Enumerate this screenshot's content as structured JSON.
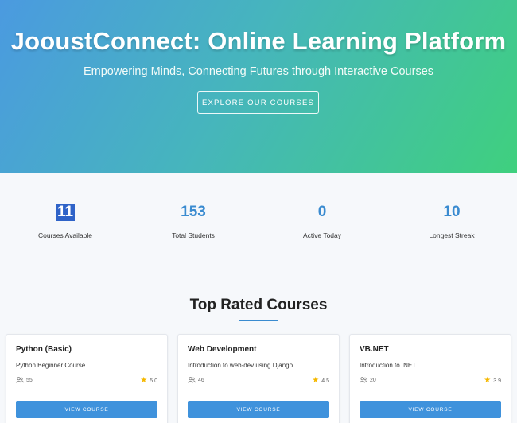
{
  "hero": {
    "title": "JooustConnect: Online Learning Platform",
    "subtitle": "Empowering Minds, Connecting Futures through Interactive Courses",
    "cta_label": "EXPLORE OUR COURSES"
  },
  "stats": [
    {
      "value": "11",
      "label": "Courses Available"
    },
    {
      "value": "153",
      "label": "Total Students"
    },
    {
      "value": "0",
      "label": "Active Today"
    },
    {
      "value": "10",
      "label": "Longest Streak"
    }
  ],
  "top_rated": {
    "title": "Top Rated Courses",
    "courses": [
      {
        "title": "Python (Basic)",
        "description": "Python Beginner Course",
        "students": "55",
        "rating": "5.0",
        "button_label": "VIEW COURSE"
      },
      {
        "title": "Web Development",
        "description": "Introduction to web-dev using Django",
        "students": "46",
        "rating": "4.5",
        "button_label": "VIEW COURSE"
      },
      {
        "title": "VB.NET",
        "description": "Introduction to .NET",
        "students": "20",
        "rating": "3.9",
        "button_label": "VIEW COURSE"
      }
    ]
  },
  "icons": {
    "students": "users-icon",
    "rating": "star-icon"
  },
  "colors": {
    "accent": "#3a8bd0",
    "button": "#3f92dc",
    "star": "#f5b800",
    "hero_start": "#4b9ae0",
    "hero_end": "#3fd07e"
  }
}
